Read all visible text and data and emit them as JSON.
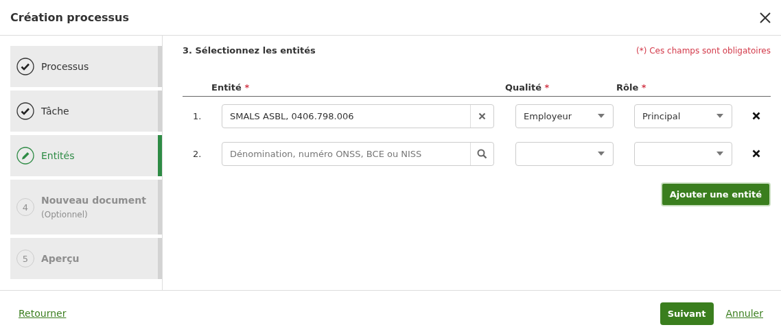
{
  "window": {
    "title": "Création processus"
  },
  "steps": [
    {
      "label": "Processus",
      "kind": "done"
    },
    {
      "label": "Tâche",
      "kind": "done"
    },
    {
      "label": "Entités",
      "kind": "current"
    },
    {
      "label": "Nouveau document",
      "note": "(Optionnel)",
      "number": "4",
      "kind": "todo"
    },
    {
      "label": "Aperçu",
      "number": "5",
      "kind": "todo"
    }
  ],
  "section_title": "3. Sélectionnez les entités",
  "required_note": "(*) Ces champs sont obligatoires",
  "columns": [
    {
      "label": "Entité",
      "mark": "*"
    },
    {
      "label": "Qualité",
      "mark": "*"
    },
    {
      "label": "Rôle",
      "mark": "*"
    }
  ],
  "rows": [
    {
      "number": "1.",
      "entity": {
        "value": "SMALS ASBL, 0406.798.006",
        "kind": "clear"
      },
      "quality": "Employeur",
      "role": "Principal"
    },
    {
      "number": "2.",
      "entity": {
        "placeholder": "Dénomination, numéro ONSS, BCE ou NISS",
        "kind": "search"
      }
    }
  ],
  "add_button": "Ajouter une entité",
  "footer": {
    "back": "Retourner",
    "next": "Suivant",
    "cancel": "Annuler"
  }
}
